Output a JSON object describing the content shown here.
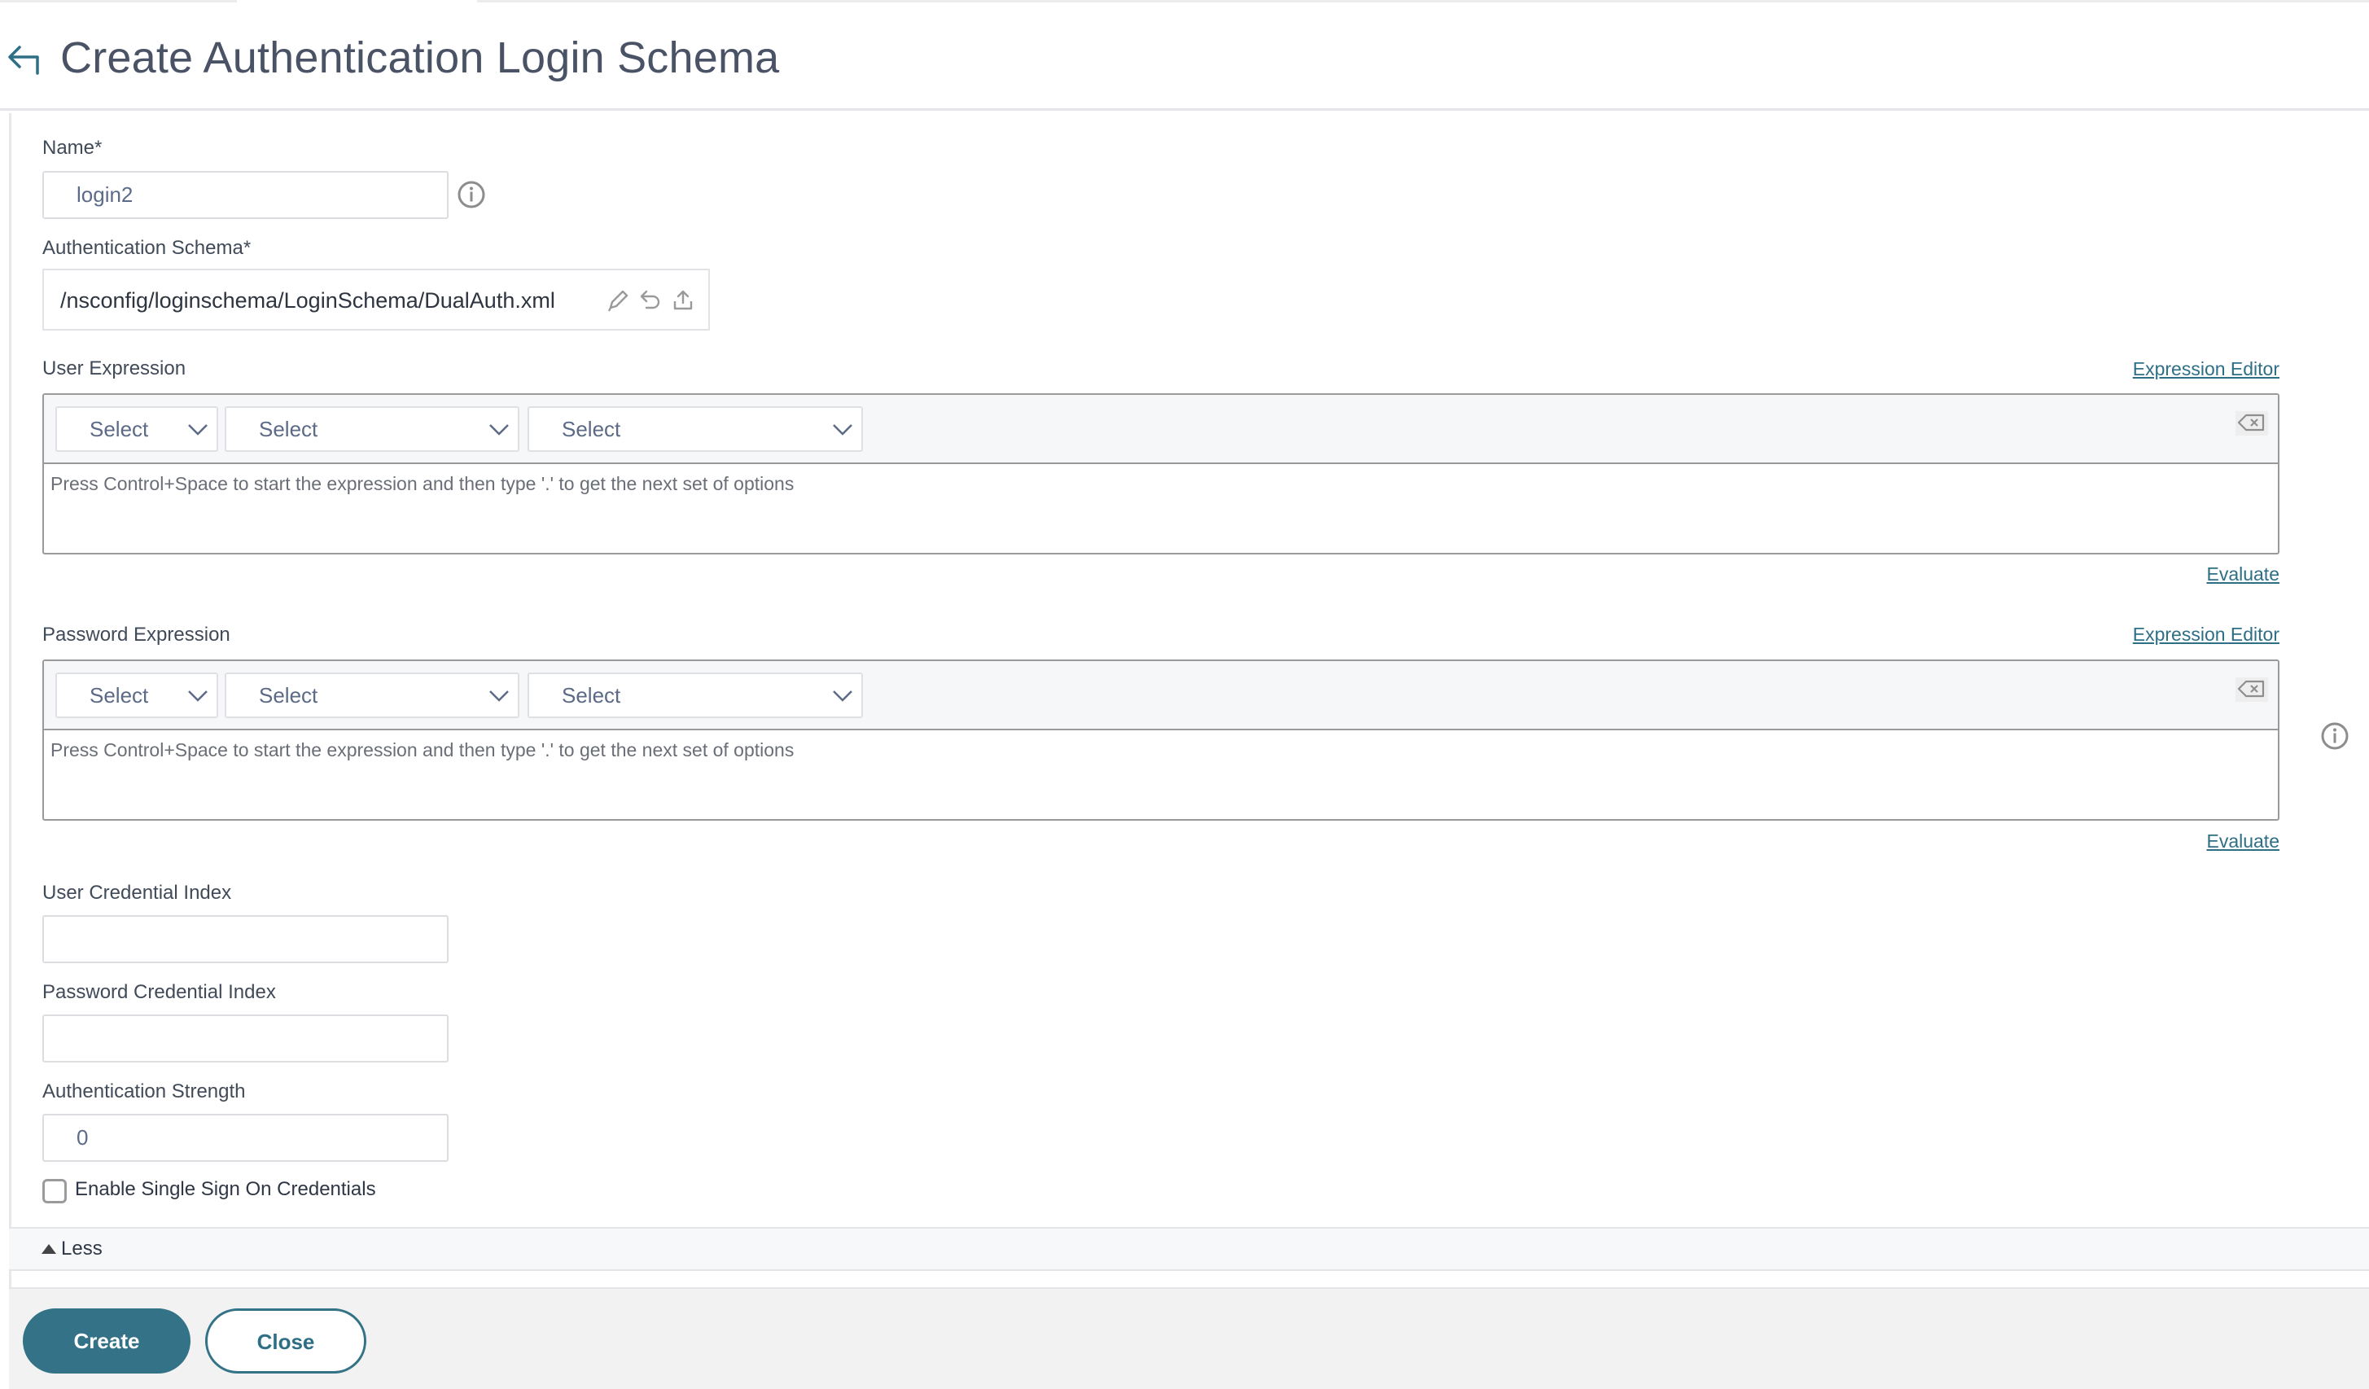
{
  "header": {
    "title": "Create Authentication Login Schema",
    "back_icon": "back-arrow-icon"
  },
  "form": {
    "name": {
      "label": "Name*",
      "value": "login2",
      "info_icon": "info-icon"
    },
    "schema": {
      "label": "Authentication Schema*",
      "value": "/nsconfig/loginschema/LoginSchema/DualAuth.xml",
      "icons": [
        "edit-pencil-icon",
        "undo-icon",
        "upload-icon"
      ]
    },
    "user_expression": {
      "label": "User Expression",
      "editor_link": "Expression Editor",
      "selects": [
        "Select",
        "Select",
        "Select"
      ],
      "placeholder": "Press Control+Space to start the expression and then type '.' to get the next set of options",
      "evaluate_link": "Evaluate",
      "clear_icon": "clear-backspace-icon"
    },
    "password_expression": {
      "label": "Password Expression",
      "editor_link": "Expression Editor",
      "selects": [
        "Select",
        "Select",
        "Select"
      ],
      "placeholder": "Press Control+Space to start the expression and then type '.' to get the next set of options",
      "evaluate_link": "Evaluate",
      "clear_icon": "clear-backspace-icon"
    },
    "user_credential_index": {
      "label": "User Credential Index",
      "value": ""
    },
    "password_credential_index": {
      "label": "Password Credential Index",
      "value": ""
    },
    "authentication_strength": {
      "label": "Authentication Strength",
      "value": "0"
    },
    "sso_checkbox": {
      "label": "Enable Single Sign On Credentials",
      "checked": false
    },
    "less_toggle": "Less"
  },
  "footer": {
    "create_label": "Create",
    "close_label": "Close"
  },
  "colors": {
    "accent": "#337287",
    "link": "#2e6f86",
    "title": "#4a5366",
    "footer_bg": "#f2f2f2"
  }
}
